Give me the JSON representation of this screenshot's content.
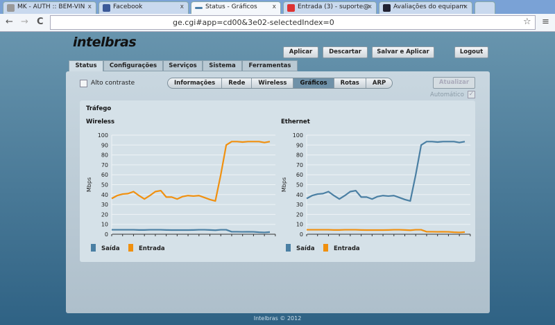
{
  "browser": {
    "tabs": [
      {
        "label": "MK - AUTH :: BEM-VIN",
        "color": "#999"
      },
      {
        "label": "Facebook",
        "color": "#3b5998"
      },
      {
        "label": "Status - Gráficos",
        "color": "#4a7fa8"
      },
      {
        "label": "Entrada (3) - suporte@",
        "color": "#d33"
      },
      {
        "label": "Avaliações do equipam",
        "color": "#223"
      }
    ],
    "url": "ge.cgi#app=cd00&3e02-selectedIndex=0",
    "back": "←",
    "forward": "→",
    "reload": "C",
    "star": "☆",
    "menu": "≡",
    "close": "x"
  },
  "header": {
    "logo": "intelbras",
    "buttons": [
      "Aplicar",
      "Descartar",
      "Salvar e Aplicar",
      "Logout"
    ]
  },
  "main_tabs": [
    "Status",
    "Configurações",
    "Serviços",
    "Sistema",
    "Ferramentas"
  ],
  "high_contrast": "Alto contraste",
  "sub_tabs": [
    "Informações",
    "Rede",
    "Wireless",
    "Gráficos",
    "Rotas",
    "ARP"
  ],
  "refresh": "Atualizar",
  "automatic": "Automático",
  "section_title": "Tráfego",
  "footer": "Intelbras © 2012",
  "chart_data": [
    {
      "type": "line",
      "title": "Wireless",
      "ylabel": "Mbps",
      "ylim": [
        0,
        100
      ],
      "yticks": [
        0,
        10,
        20,
        30,
        40,
        50,
        60,
        70,
        80,
        90,
        100
      ],
      "grid": true,
      "legend": "bottom-left",
      "series": [
        {
          "name": "Saída",
          "color": "#4a7fa3",
          "values": [
            4.5,
            4.5,
            4.5,
            4.5,
            4.5,
            4.3,
            4.3,
            4.5,
            4.5,
            4.5,
            4.3,
            4.2,
            4.2,
            4.2,
            4.2,
            4.3,
            4.5,
            4.5,
            4.3,
            4,
            4.5,
            4.5,
            2.5,
            2.5,
            2.4,
            2.5,
            2.4,
            2,
            1.8,
            2.2
          ]
        },
        {
          "name": "Entrada",
          "color": "#f0900f",
          "values": [
            36,
            39,
            40.5,
            41,
            43,
            39,
            35.5,
            39,
            43,
            44,
            37.5,
            37.5,
            35.5,
            38,
            39,
            38.5,
            39,
            37,
            35,
            33.5,
            60,
            90,
            93.5,
            93.5,
            93,
            93.5,
            93.5,
            93.5,
            92.5,
            93.5
          ]
        }
      ]
    },
    {
      "type": "line",
      "title": "Ethernet",
      "ylabel": "Mbps",
      "ylim": [
        0,
        100
      ],
      "yticks": [
        0,
        10,
        20,
        30,
        40,
        50,
        60,
        70,
        80,
        90,
        100
      ],
      "grid": true,
      "legend": "bottom-left",
      "series": [
        {
          "name": "Saída",
          "color": "#4a7fa3",
          "values": [
            36,
            39,
            40.5,
            41,
            43,
            39,
            35.5,
            39,
            43,
            44,
            37.5,
            37.5,
            35.5,
            38,
            39,
            38.5,
            39,
            37,
            35,
            33.5,
            60,
            90,
            93.5,
            93.5,
            93,
            93.5,
            93.5,
            93.5,
            92.5,
            93.5
          ]
        },
        {
          "name": "Entrada",
          "color": "#f0900f",
          "values": [
            4.5,
            4.5,
            4.5,
            4.5,
            4.5,
            4.3,
            4.3,
            4.5,
            4.5,
            4.5,
            4.3,
            4.2,
            4.2,
            4.2,
            4.2,
            4.3,
            4.5,
            4.5,
            4.3,
            4,
            4.5,
            4.5,
            2.5,
            2.5,
            2.4,
            2.5,
            2.4,
            2,
            1.8,
            2.2
          ]
        }
      ]
    }
  ]
}
